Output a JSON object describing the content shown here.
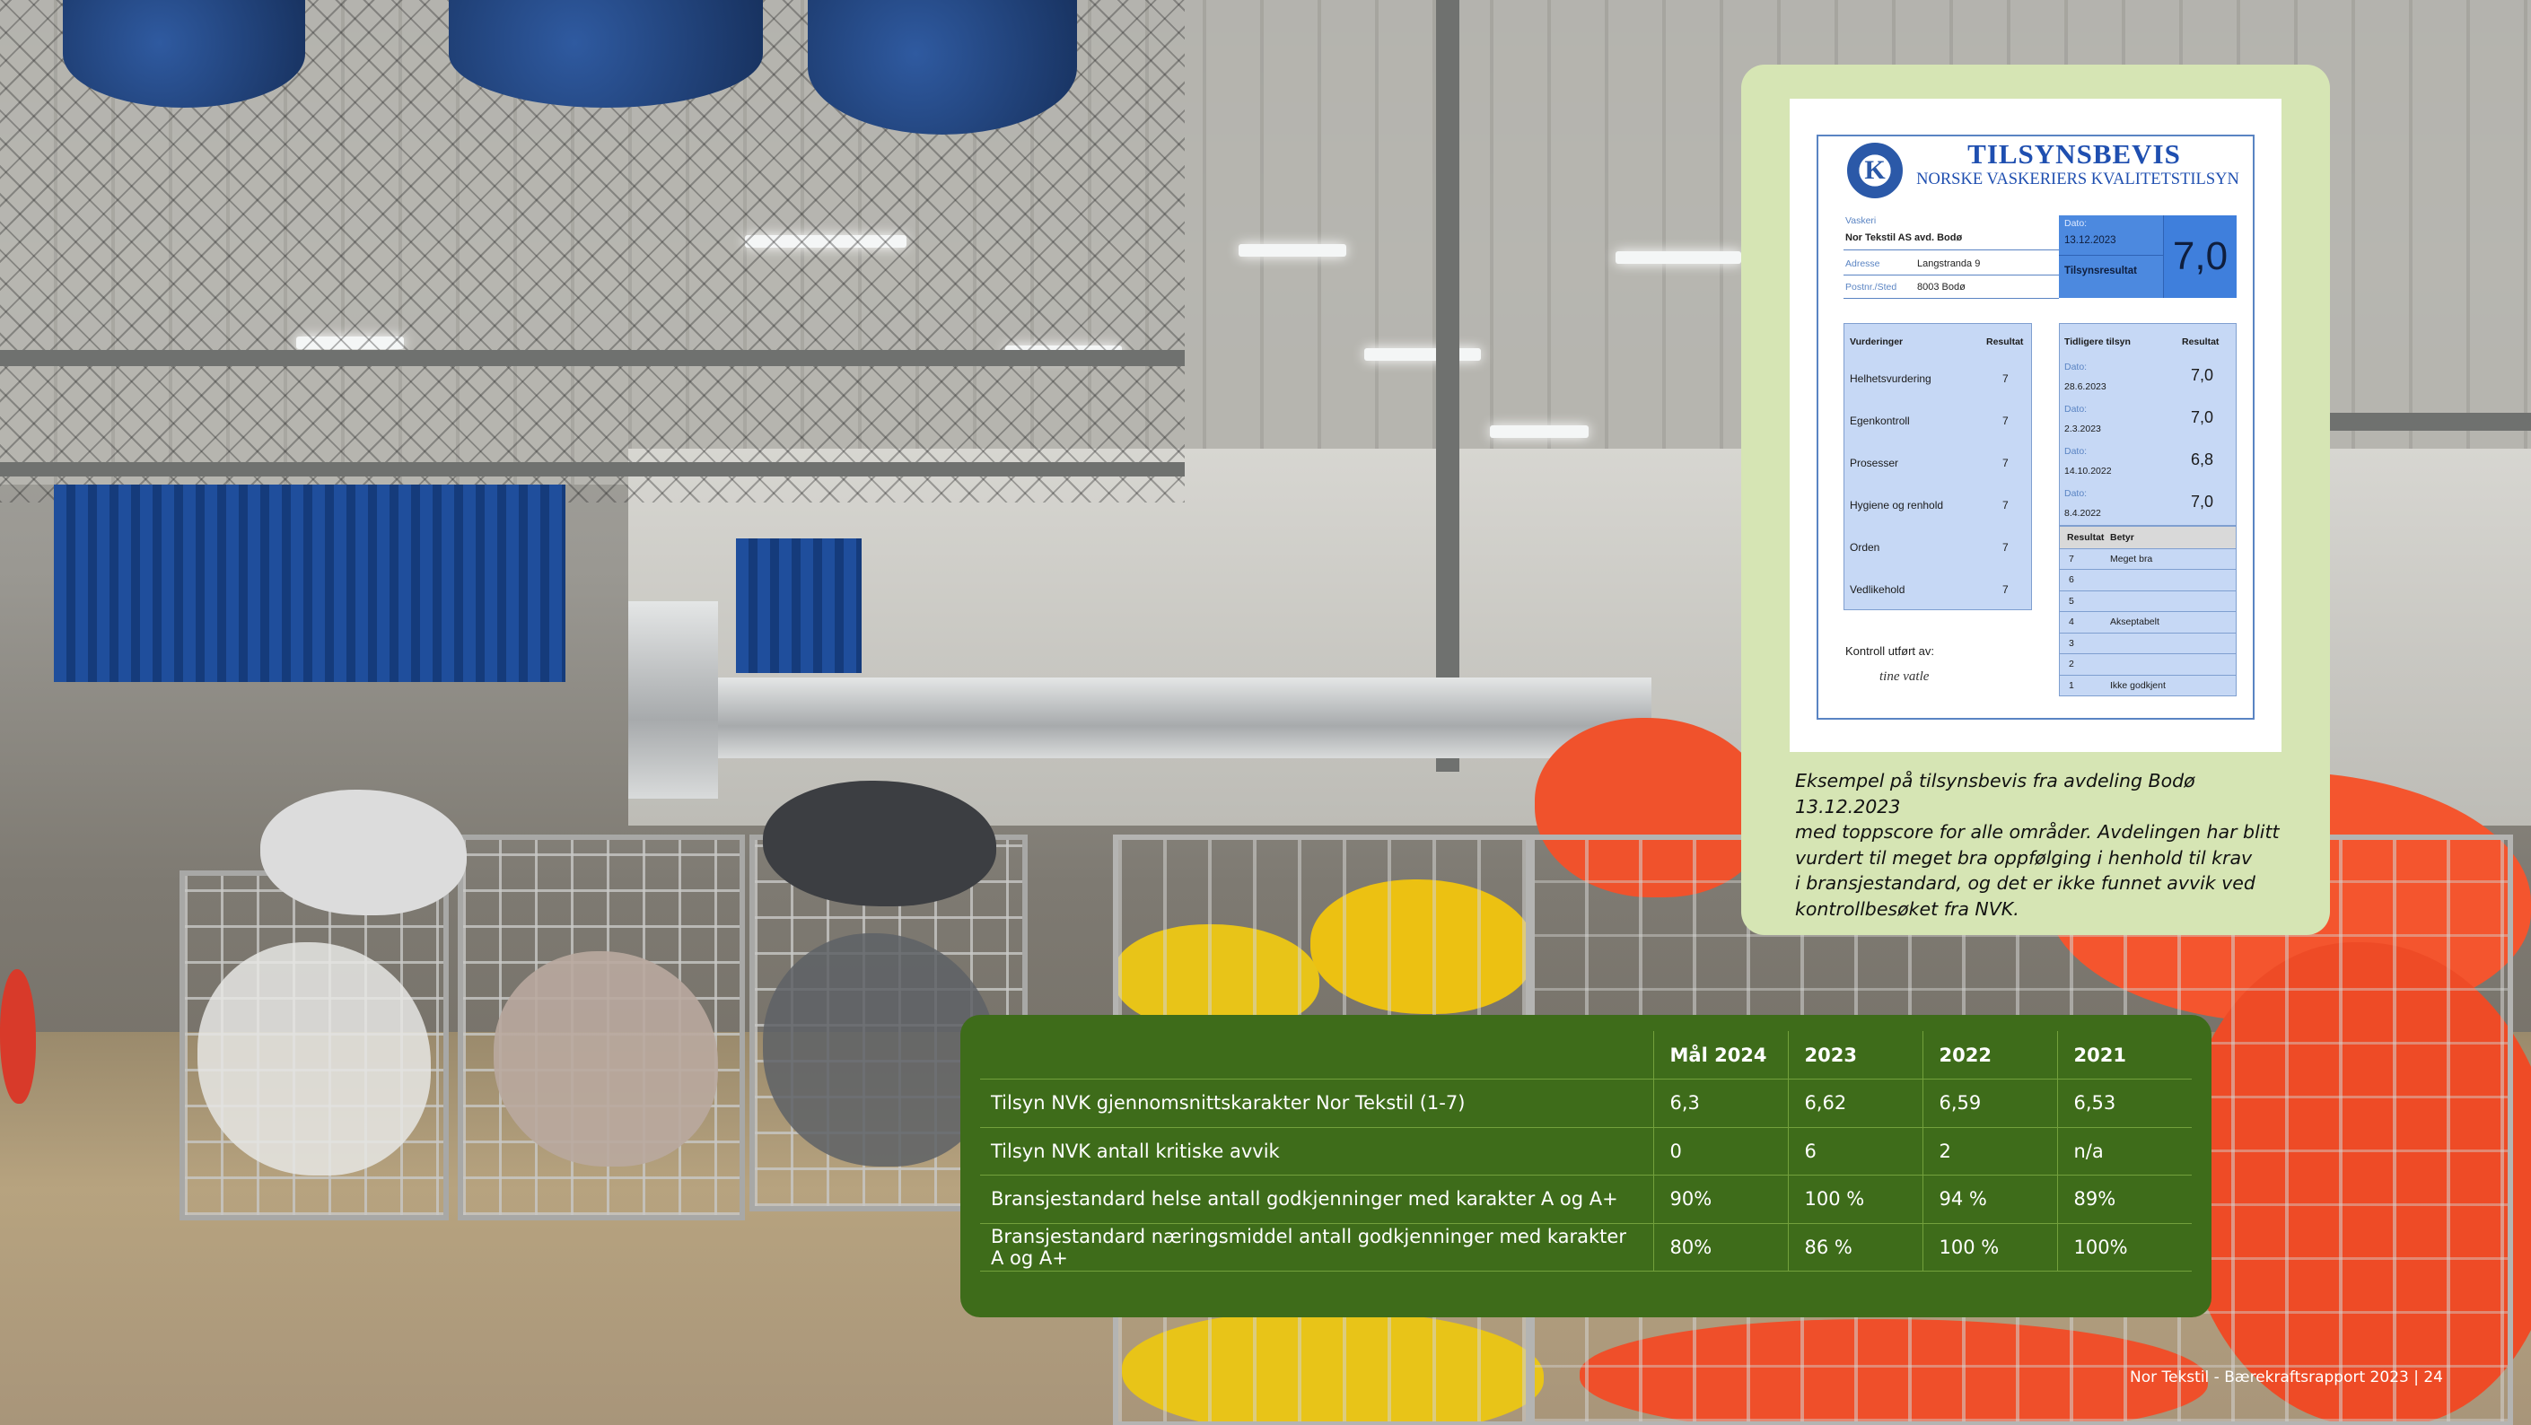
{
  "certificate": {
    "title": "TILSYNSBEVIS",
    "subtitle": "NORSKE VASKERIERS KVALITETSTILSYN",
    "logo_letter": "K",
    "fields": {
      "vaskeri_label": "Vaskeri",
      "vaskeri_value": "Nor Tekstil AS avd. Bodø",
      "adresse_label": "Adresse",
      "adresse_value": "Langstranda 9",
      "poststed_label": "Postnr./Sted",
      "poststed_value": "8003 Bodø",
      "date_label": "Dato:",
      "date_value": "13.12.2023",
      "result_label": "Tilsynsresultat",
      "result_value": "7,0"
    },
    "assessments": {
      "header_left": "Vurderinger",
      "header_right": "Resultat",
      "rows": [
        {
          "label": "Helhetsvurdering",
          "value": "7"
        },
        {
          "label": "Egenkontroll",
          "value": "7"
        },
        {
          "label": "Prosesser",
          "value": "7"
        },
        {
          "label": "Hygiene og renhold",
          "value": "7"
        },
        {
          "label": "Orden",
          "value": "7"
        },
        {
          "label": "Vedlikehold",
          "value": "7"
        }
      ]
    },
    "previous": {
      "header_left": "Tidligere tilsyn",
      "header_right": "Resultat",
      "rows": [
        {
          "date_label": "Dato:",
          "date": "28.6.2023",
          "value": "7,0"
        },
        {
          "date_label": "Dato:",
          "date": "2.3.2023",
          "value": "7,0"
        },
        {
          "date_label": "Dato:",
          "date": "14.10.2022",
          "value": "6,8"
        },
        {
          "date_label": "Dato:",
          "date": "8.4.2022",
          "value": "7,0"
        }
      ]
    },
    "scale": {
      "header_left": "Resultat",
      "header_right": "Betyr",
      "rows": [
        {
          "grade": "7",
          "meaning": "Meget bra"
        },
        {
          "grade": "6",
          "meaning": ""
        },
        {
          "grade": "5",
          "meaning": ""
        },
        {
          "grade": "4",
          "meaning": "Akseptabelt"
        },
        {
          "grade": "3",
          "meaning": ""
        },
        {
          "grade": "2",
          "meaning": ""
        },
        {
          "grade": "1",
          "meaning": "Ikke godkjent"
        }
      ]
    },
    "signature_label": "Kontroll utført av:",
    "signature": "tine vatle"
  },
  "caption": [
    "Eksempel på tilsynsbevis fra avdeling Bodø 13.12.2023",
    "med toppscore for alle områder. Avdelingen har blitt",
    "vurdert til meget bra oppfølging i henhold til krav",
    "i bransjestandard, og det er ikke funnet avvik ved",
    "kontrollbesøket fra NVK."
  ],
  "kpi_table": {
    "headers": [
      "",
      "Mål 2024",
      "2023",
      "2022",
      "2021"
    ],
    "rows": [
      [
        "Tilsyn NVK gjennomsnittskarakter Nor Tekstil (1-7)",
        "6,3",
        "6,62",
        "6,59",
        "6,53"
      ],
      [
        "Tilsyn NVK antall kritiske avvik",
        "0",
        "6",
        "2",
        "n/a"
      ],
      [
        "Bransjestandard helse antall godkjenninger med karakter A og A+",
        "90%",
        "100 %",
        "94 %",
        "89%"
      ],
      [
        "Bransjestandard næringsmiddel antall godkjenninger med karakter A og A+",
        "80%",
        "86 %",
        "100 %",
        "100%"
      ]
    ]
  },
  "footer": "Nor Tekstil - Bærekraftsrapport 2023  |  24",
  "colors": {
    "card_bg": "#d6e5b4",
    "table_bg": "#3e6c1a",
    "cert_blue": "#1f4fb0",
    "score_blue": "#3f7fdc"
  }
}
